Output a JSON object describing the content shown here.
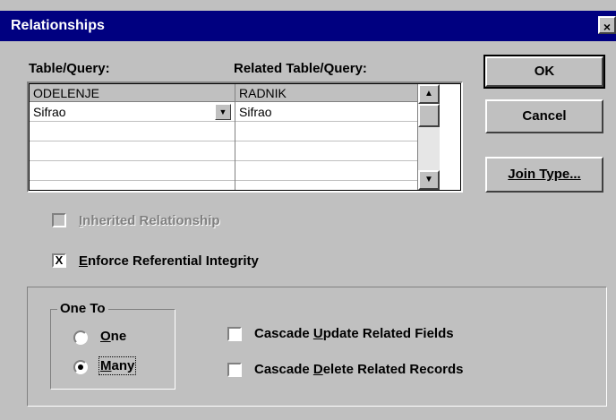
{
  "window": {
    "title": "Relationships",
    "close_glyph": "×"
  },
  "labels": {
    "table_query": "Table/Query:",
    "related_table_query": "Related Table/Query:"
  },
  "grid": {
    "left_header": "ODELENJE",
    "right_header": "RADNIK",
    "rows": [
      {
        "left": "Sifrao",
        "right": "Sifrao"
      },
      {
        "left": "",
        "right": ""
      },
      {
        "left": "",
        "right": ""
      },
      {
        "left": "",
        "right": ""
      }
    ]
  },
  "buttons": {
    "ok": "OK",
    "cancel": "Cancel",
    "join_type": "Join Type..."
  },
  "options": {
    "inherited": {
      "label_u": "I",
      "label_rest": "nherited Relationship",
      "checked": false,
      "enabled": false
    },
    "enforce": {
      "label_u": "E",
      "label_rest": "nforce Referential Integrity",
      "checked": true,
      "mark": "X"
    }
  },
  "one_to": {
    "legend": "One To",
    "one": {
      "label_u": "O",
      "label_rest": "ne",
      "selected": false
    },
    "many": {
      "label_u": "M",
      "label_rest": "any",
      "selected": true
    }
  },
  "cascade": {
    "update": {
      "pre": "Cascade ",
      "u": "U",
      "post": "pdate Related Fields",
      "checked": false
    },
    "delete": {
      "pre": "Cascade ",
      "u": "D",
      "post": "elete Related Records",
      "checked": false
    }
  },
  "icons": {
    "combo_arrow": "combo-dropdown-arrow-icon",
    "scroll_up": "scroll-up-arrow-icon",
    "scroll_down": "scroll-down-arrow-icon"
  }
}
